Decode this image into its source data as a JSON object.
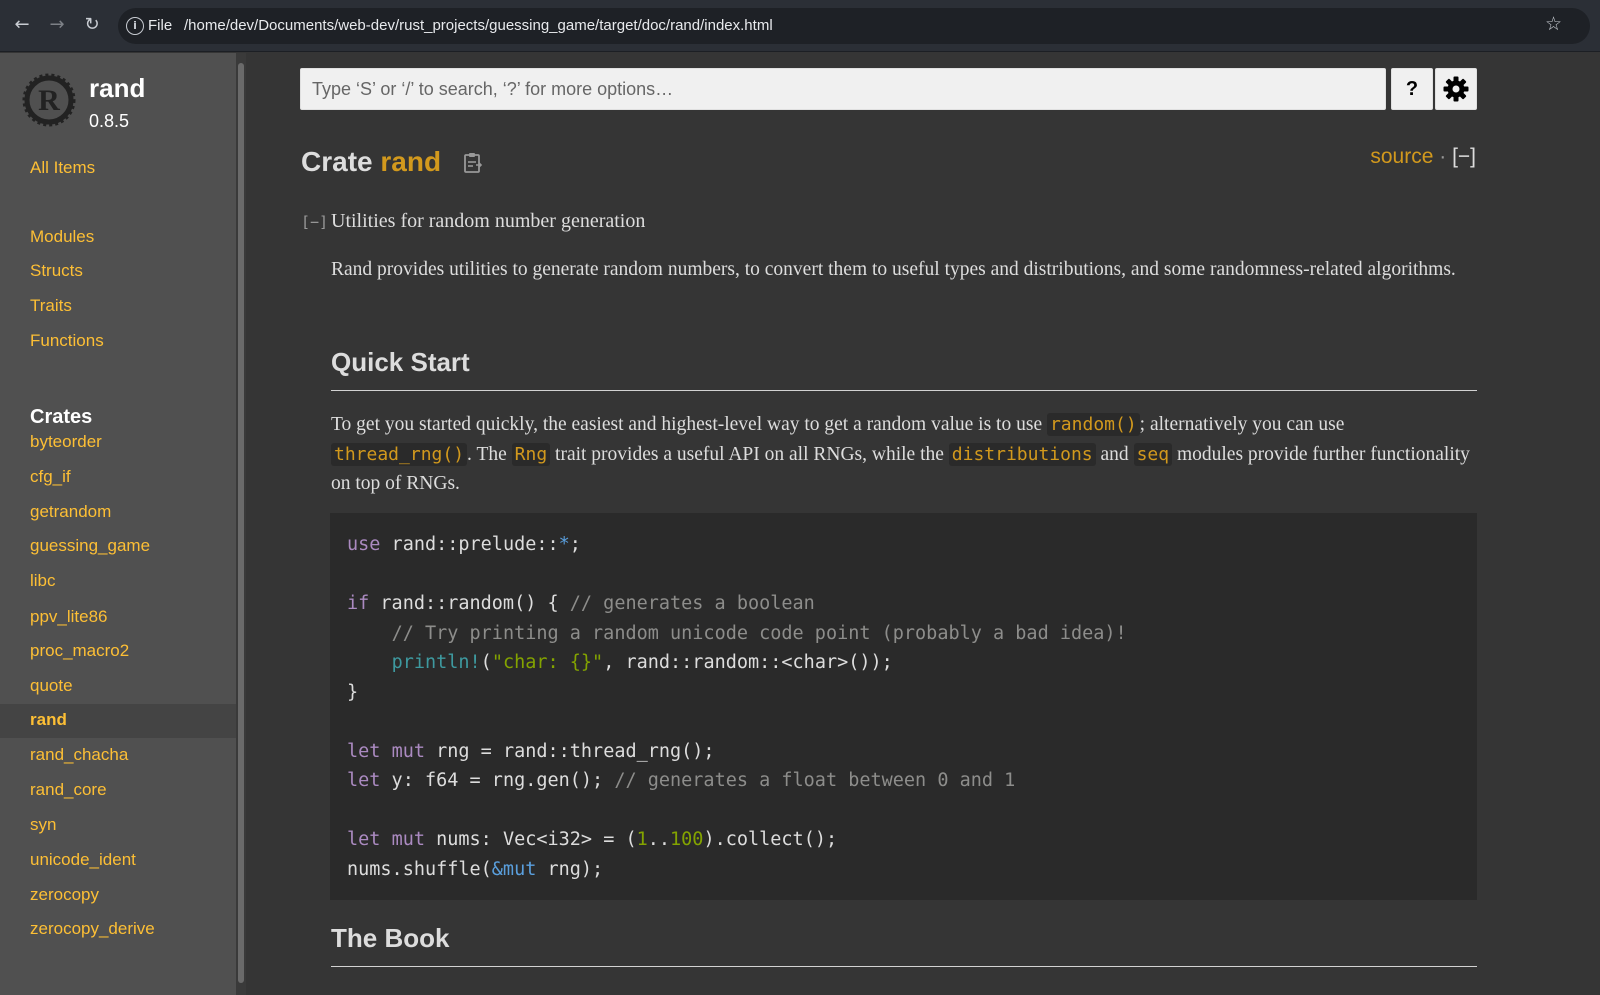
{
  "browser": {
    "file_label": "File",
    "url": "/home/dev/Documents/web-dev/rust_projects/guessing_game/target/doc/rand/index.html"
  },
  "sidebar": {
    "crate_name": "rand",
    "version": "0.8.5",
    "all_items": "All Items",
    "sections": [
      "Modules",
      "Structs",
      "Traits",
      "Functions"
    ],
    "crates_heading": "Crates",
    "crates": [
      "byteorder",
      "cfg_if",
      "getrandom",
      "guessing_game",
      "libc",
      "ppv_lite86",
      "proc_macro2",
      "quote",
      "rand",
      "rand_chacha",
      "rand_core",
      "syn",
      "unicode_ident",
      "zerocopy",
      "zerocopy_derive"
    ],
    "current_crate": "rand"
  },
  "search": {
    "placeholder": "Type ‘S’ or ‘/’ to search, ‘?’ for more options…",
    "help_label": "?"
  },
  "main": {
    "title_prefix": "Crate",
    "title_name": "rand",
    "source_label": "source",
    "separator": "·",
    "toggle_label": "[−]",
    "collapse_label": "[−]",
    "summary": "Utilities for random number generation",
    "intro": "Rand provides utilities to generate random numbers, to convert them to useful types and distributions, and some randomness-related algorithms.",
    "quick_start_heading": "Quick Start",
    "quick_start": {
      "t1": "To get you started quickly, the easiest and highest-level way to get a random value is to use ",
      "c1": "random()",
      "t2": "; alternatively you can use ",
      "c2": "thread_rng()",
      "t3": ". The ",
      "c3": "Rng",
      "t4": " trait provides a useful API on all RNGs, while the ",
      "c4": "distributions",
      "t5": " and ",
      "c5": "seq",
      "t6": " modules provide further functionality on top of RNGs."
    },
    "book_heading": "The Book"
  },
  "code": {
    "l1": [
      "use",
      " rand::prelude::",
      "*",
      ";"
    ],
    "l3": [
      "if",
      " rand::random() { ",
      "// generates a boolean"
    ],
    "l4": [
      "    ",
      "// Try printing a random unicode code point (probably a bad idea)!"
    ],
    "l5": [
      "    ",
      "println!",
      "(",
      "\"char: {}\"",
      ", rand::random::<char>());"
    ],
    "l6": "}",
    "l8": [
      "let",
      " ",
      "mut",
      " rng = rand::thread_rng();"
    ],
    "l9": [
      "let",
      " y: f64 = rng.gen(); ",
      "// generates a float between 0 and 1"
    ],
    "l11": [
      "let",
      " ",
      "mut",
      " nums: Vec<i32> = (",
      "1",
      "..",
      "100",
      ").collect();"
    ],
    "l12": [
      "nums.shuffle(",
      "&mut",
      " rng);"
    ]
  }
}
